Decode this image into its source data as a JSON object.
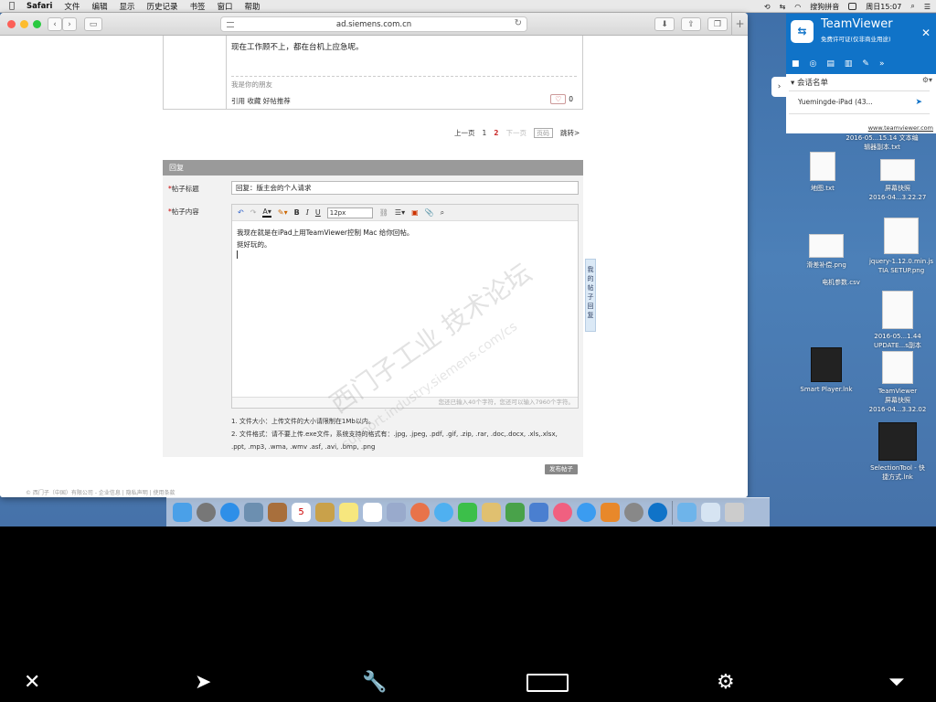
{
  "menubar": {
    "app": "Safari",
    "items": [
      "文件",
      "编辑",
      "显示",
      "历史记录",
      "书签",
      "窗口",
      "帮助"
    ],
    "input_method": "搜狗拼音",
    "clock": "周日15:07"
  },
  "safari": {
    "url": "ad.siemens.com.cn"
  },
  "post": {
    "body": "现在工作顾不上，都在台机上应急呢。",
    "signature": "我是你的朋友",
    "actions": "引用  收藏  好帖推荐",
    "likes": "0"
  },
  "pager": {
    "prev": "上一页",
    "page1": "1",
    "page2": "2",
    "next": "下一页",
    "page_input_placeholder": "页码",
    "goto": "跳转>"
  },
  "reply": {
    "header": "回复",
    "title_label": "帖子标题",
    "title_value": "回复：版主会的个人请求",
    "content_label": "帖子内容",
    "font_size": "12px",
    "content_lines": [
      "我现在就是在iPad上用TeamViewer控制 Mac 给你回帖。",
      "挺好玩的。"
    ],
    "char_count": "您还已输入40个字符，您还可以输入7960个字符。",
    "note1": "1. 文件大小：上传文件的大小请限制在1Mb以内。",
    "note2": "2. 文件格式：请不要上传.exe文件，系统支持的格式有：.jpg, .jpeg, .pdf, .gif, .zip, .rar, .doc,.docx, .xls,.xlsx,",
    "note3": ".ppt, .mp3, .wma, .wmv .asf, .avi, .bmp, .png",
    "side_tab": "我的帖子   回复",
    "submit": "发布帖子"
  },
  "footer": "© 西门子（中国）有限公司 - 企业信息 | 隐私声明 | 使用条款",
  "watermark": "西门子工业   技术论坛",
  "watermark_url": "support.industry.siemens.com/cs",
  "teamviewer": {
    "title": "TeamViewer",
    "subtitle": "免费许可证(仅非商业用途)",
    "session_list": "会话名单",
    "device": "Yuemingde-iPad (43...",
    "link": "www.teamviewer.com"
  },
  "desktop": {
    "icons": [
      {
        "label": "2016-05...15.14\n文本编辑器副本.txt"
      },
      {
        "label": "地图.txt"
      },
      {
        "label": "屏幕快照\n2016-04...3.22.27"
      },
      {
        "label": "滑差补偿.png"
      },
      {
        "label": "电机参数.csv"
      },
      {
        "label": "jquery-1.12.0.min.js\nTIA SETUP.png"
      },
      {
        "label": "2016-05...1.44\nUPDATE...s副本"
      },
      {
        "label": "Smart Player.lnk"
      },
      {
        "label": "TeamViewer\n屏幕快照\n2016-04...3.32.02"
      },
      {
        "label": "SelectionTool - 快\n捷方式.lnk"
      }
    ]
  },
  "dock": {
    "calendar_day": "5"
  },
  "colors": {
    "tv_blue": "#1073c8",
    "reply_header": "#9a9a9a",
    "desktop": "#4672a9"
  }
}
